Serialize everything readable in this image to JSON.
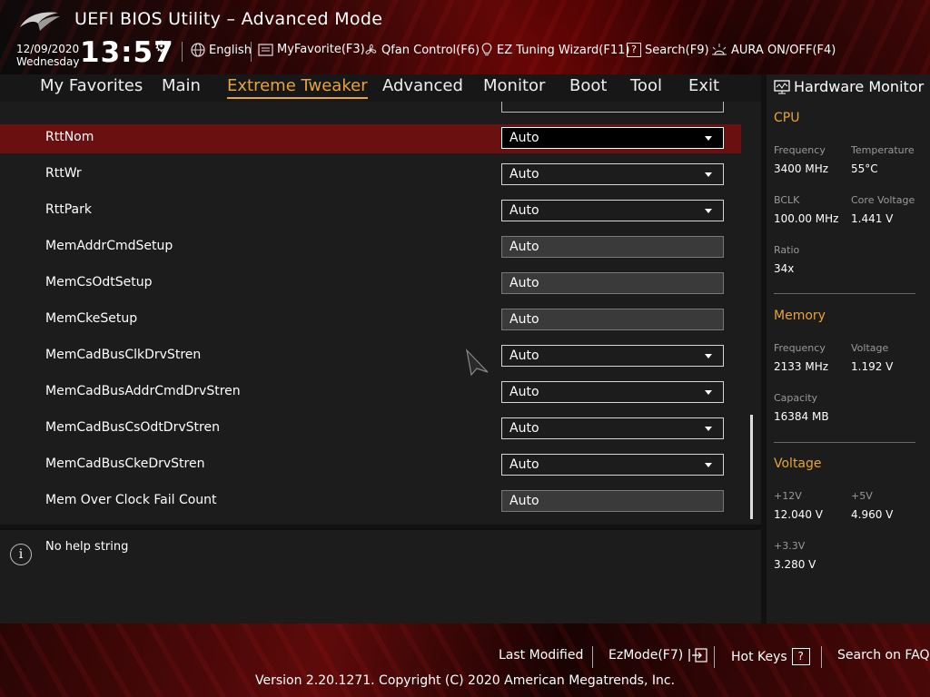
{
  "header": {
    "title": "UEFI BIOS Utility – Advanced Mode",
    "date": "12/09/2020",
    "day": "Wednesday",
    "time": "13:57",
    "items": [
      {
        "label": "English",
        "icon": "globe-icon"
      },
      {
        "label": "MyFavorite(F3)",
        "icon": "favorite-list-icon"
      },
      {
        "label": "Qfan Control(F6)",
        "icon": "fan-icon"
      },
      {
        "label": "EZ Tuning Wizard(F11)",
        "icon": "lightbulb-icon"
      },
      {
        "label": "Search(F9)",
        "icon": "search-question-icon"
      },
      {
        "label": "AURA ON/OFF(F4)",
        "icon": "aura-light-icon"
      }
    ]
  },
  "tabs": [
    "My Favorites",
    "Main",
    "Extreme Tweaker",
    "Advanced",
    "Monitor",
    "Boot",
    "Tool",
    "Exit"
  ],
  "active_tab": "Extreme Tweaker",
  "settings": [
    {
      "name": "RttNom",
      "value": "Auto",
      "type": "dropdown",
      "selected": true
    },
    {
      "name": "RttWr",
      "value": "Auto",
      "type": "dropdown"
    },
    {
      "name": "RttPark",
      "value": "Auto",
      "type": "dropdown"
    },
    {
      "name": "MemAddrCmdSetup",
      "value": "Auto",
      "type": "readonly"
    },
    {
      "name": "MemCsOdtSetup",
      "value": "Auto",
      "type": "readonly"
    },
    {
      "name": "MemCkeSetup",
      "value": "Auto",
      "type": "readonly"
    },
    {
      "name": "MemCadBusClkDrvStren",
      "value": "Auto",
      "type": "dropdown"
    },
    {
      "name": "MemCadBusAddrCmdDrvStren",
      "value": "Auto",
      "type": "dropdown"
    },
    {
      "name": "MemCadBusCsOdtDrvStren",
      "value": "Auto",
      "type": "dropdown"
    },
    {
      "name": "MemCadBusCkeDrvStren",
      "value": "Auto",
      "type": "dropdown"
    },
    {
      "name": "Mem Over Clock Fail Count",
      "value": "Auto",
      "type": "readonly"
    }
  ],
  "help": {
    "text": "No help string"
  },
  "hardware_monitor": {
    "title": "Hardware Monitor",
    "cpu": {
      "title": "CPU",
      "frequency_label": "Frequency",
      "frequency": "3400 MHz",
      "temperature_label": "Temperature",
      "temperature": "55°C",
      "bclk_label": "BCLK",
      "bclk": "100.00 MHz",
      "core_voltage_label": "Core Voltage",
      "core_voltage": "1.441 V",
      "ratio_label": "Ratio",
      "ratio": "34x"
    },
    "memory": {
      "title": "Memory",
      "frequency_label": "Frequency",
      "frequency": "2133 MHz",
      "voltage_label": "Voltage",
      "voltage": "1.192 V",
      "capacity_label": "Capacity",
      "capacity": "16384 MB"
    },
    "voltage": {
      "title": "Voltage",
      "v12_label": "+12V",
      "v12": "12.040 V",
      "v5_label": "+5V",
      "v5": "4.960 V",
      "v33_label": "+3.3V",
      "v33": "3.280 V"
    }
  },
  "footer": {
    "last_modified": "Last Modified",
    "ezmode": "EzMode(F7)",
    "hot_keys": "Hot Keys",
    "hot_keys_key": "?",
    "search_faq": "Search on FAQ",
    "copyright": "Version 2.20.1271. Copyright (C) 2020 American Megatrends, Inc."
  },
  "colors": {
    "accent": "#e8a33a",
    "selected_row": "#6b1010"
  }
}
